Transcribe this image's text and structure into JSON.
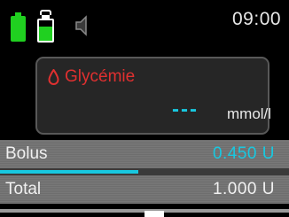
{
  "status_bar": {
    "time": "09:00",
    "battery_icon": "battery-full-icon",
    "cartridge_icon": "insulin-cartridge-icon",
    "speaker_icon": "speaker-muted-icon",
    "battery_level": 1.0,
    "cartridge_level": 0.7
  },
  "glycemia": {
    "label": "Glycémie",
    "icon": "blood-drop-icon",
    "value": "---",
    "unit": "mmol/l"
  },
  "bolus": {
    "label": "Bolus",
    "value": "0.450  U",
    "progress": 0.45
  },
  "total": {
    "label": "Total",
    "value": "1.000  U"
  },
  "colors": {
    "background": "#000000",
    "accent_cyan": "#18c8e0",
    "alert_red": "#e03030",
    "battery_green": "#20d020",
    "panel": "#262626",
    "row_gray": "#6e6e6e"
  }
}
